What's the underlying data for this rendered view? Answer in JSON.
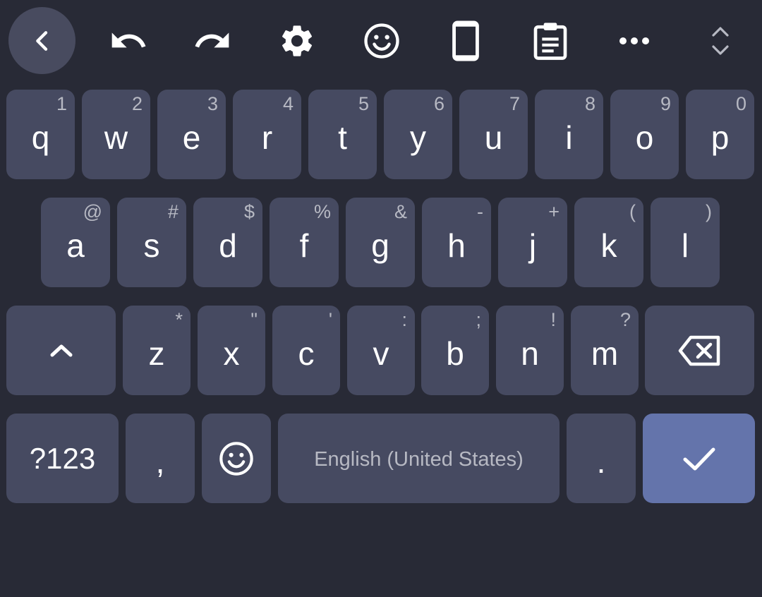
{
  "toolbar": {
    "buttons": [
      {
        "name": "back-button",
        "icon": "chevron-left-icon"
      },
      {
        "name": "undo-button",
        "icon": "undo-icon"
      },
      {
        "name": "redo-button",
        "icon": "redo-icon"
      },
      {
        "name": "settings-button",
        "icon": "gear-icon"
      },
      {
        "name": "emoji-toolbar-button",
        "icon": "smiley-icon"
      },
      {
        "name": "one-handed-button",
        "icon": "phone-icon"
      },
      {
        "name": "clipboard-button",
        "icon": "clipboard-icon"
      },
      {
        "name": "more-button",
        "icon": "more-horizontal-icon"
      },
      {
        "name": "resize-button",
        "icon": "expand-vertical-icon"
      }
    ]
  },
  "rows": {
    "row1": [
      {
        "label": "q",
        "hint": "1"
      },
      {
        "label": "w",
        "hint": "2"
      },
      {
        "label": "e",
        "hint": "3"
      },
      {
        "label": "r",
        "hint": "4"
      },
      {
        "label": "t",
        "hint": "5"
      },
      {
        "label": "y",
        "hint": "6"
      },
      {
        "label": "u",
        "hint": "7"
      },
      {
        "label": "i",
        "hint": "8"
      },
      {
        "label": "o",
        "hint": "9"
      },
      {
        "label": "p",
        "hint": "0"
      }
    ],
    "row2": [
      {
        "label": "a",
        "hint": "@"
      },
      {
        "label": "s",
        "hint": "#"
      },
      {
        "label": "d",
        "hint": "$"
      },
      {
        "label": "f",
        "hint": "%"
      },
      {
        "label": "g",
        "hint": "&"
      },
      {
        "label": "h",
        "hint": "-"
      },
      {
        "label": "j",
        "hint": "+"
      },
      {
        "label": "k",
        "hint": "("
      },
      {
        "label": "l",
        "hint": ")"
      }
    ],
    "row3": [
      {
        "label": "z",
        "hint": "*"
      },
      {
        "label": "x",
        "hint": "\""
      },
      {
        "label": "c",
        "hint": "'"
      },
      {
        "label": "v",
        "hint": ":"
      },
      {
        "label": "b",
        "hint": ";"
      },
      {
        "label": "n",
        "hint": "!"
      },
      {
        "label": "m",
        "hint": "?"
      }
    ]
  },
  "bottom": {
    "symbols_label": "?123",
    "comma_label": ",",
    "space_label": "English (United States)",
    "period_label": "."
  },
  "colors": {
    "background": "#282a36",
    "key": "#464a61",
    "enter_key": "#6474ab",
    "hint_text": "#b7b9c3"
  }
}
